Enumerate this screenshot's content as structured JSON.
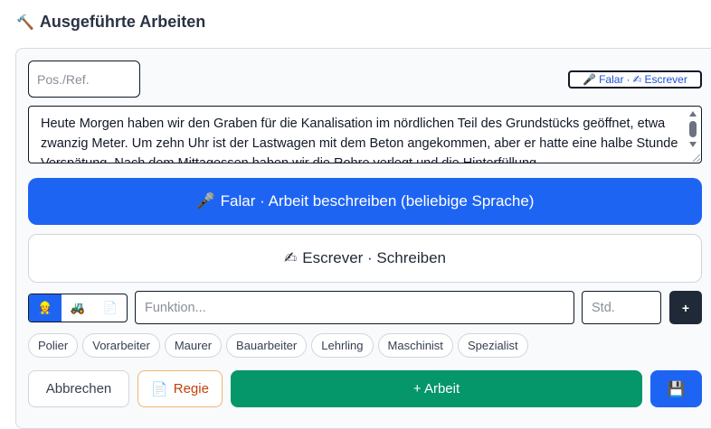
{
  "header": {
    "icon": "hammer-icon",
    "icon_glyph": "🔨",
    "title": "Ausgeführte Arbeiten"
  },
  "form": {
    "pos_ref": {
      "placeholder": "Pos./Ref.",
      "value": ""
    },
    "input_mode": {
      "speak_glyph": "🎤",
      "speak_label": "Falar",
      "separator": "·",
      "write_glyph": "✍",
      "write_label": "Escrever"
    },
    "description": {
      "value": "Heute Morgen haben wir den Graben für die Kanalisation im nördlichen Teil des Grundstücks geöffnet, etwa zwanzig Meter. Um zehn Uhr ist der Lastwagen mit dem Beton angekommen, aber er hatte eine halbe Stunde Verspätung. Nach dem Mittagessen haben wir die Rohre verlegt und die Hinterfüllung"
    },
    "speak_button": {
      "glyph": "🎤",
      "label": "Falar · Arbeit beschreiben (beliebige Sprache)"
    },
    "write_button": {
      "glyph": "✍",
      "label": "Escrever · Schreiben"
    },
    "resource_type": {
      "options": [
        {
          "name": "worker",
          "glyph": "👷"
        },
        {
          "name": "machine",
          "glyph": "🚜"
        },
        {
          "name": "material",
          "glyph": "📄"
        }
      ],
      "selected": "worker"
    },
    "function": {
      "placeholder": "Funktion...",
      "value": ""
    },
    "hours": {
      "placeholder": "Std.",
      "value": ""
    },
    "add_role_label": "+",
    "roles": [
      "Polier",
      "Vorarbeiter",
      "Maurer",
      "Bauarbeiter",
      "Lehrling",
      "Maschinist",
      "Spezialist"
    ]
  },
  "actions": {
    "cancel_label": "Abbrechen",
    "regie_glyph": "📄",
    "regie_label": "Regie",
    "add_work_label": "+ Arbeit",
    "save_glyph": "💾"
  },
  "colors": {
    "primary": "#1d64f3",
    "success": "#059669",
    "dark": "#1f2937",
    "regie_accent": "#c2410c"
  }
}
